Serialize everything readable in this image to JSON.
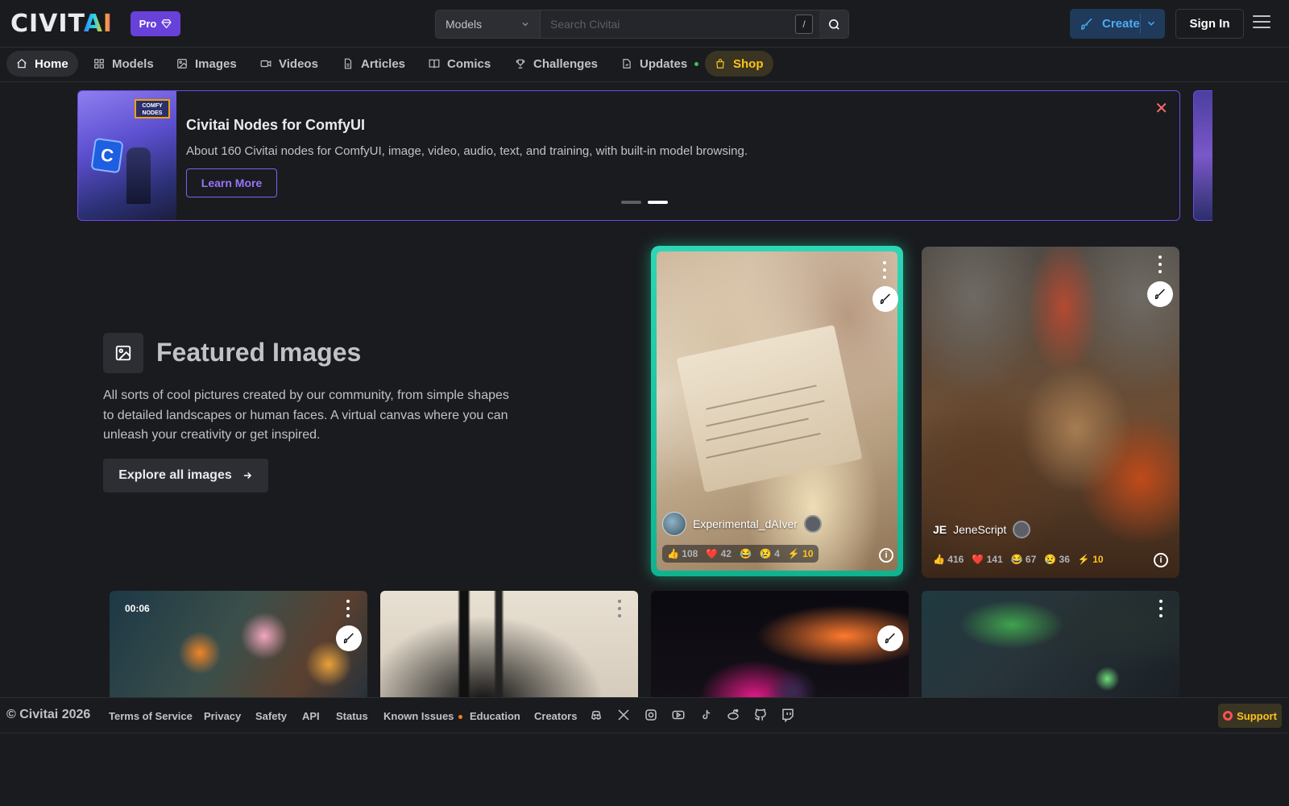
{
  "header": {
    "logo_prefix": "CIVIT",
    "logo_suffix": "AI",
    "pro_label": "Pro",
    "search": {
      "scope": "Models",
      "placeholder": "Search Civitai",
      "shortcut": "/"
    },
    "create_label": "Create",
    "signin_label": "Sign In"
  },
  "nav": {
    "items": [
      {
        "label": "Home",
        "icon": "home-icon"
      },
      {
        "label": "Models",
        "icon": "grid-icon"
      },
      {
        "label": "Images",
        "icon": "image-icon"
      },
      {
        "label": "Videos",
        "icon": "video-icon"
      },
      {
        "label": "Articles",
        "icon": "file-text-icon"
      },
      {
        "label": "Comics",
        "icon": "book-icon"
      },
      {
        "label": "Challenges",
        "icon": "trophy-icon"
      },
      {
        "label": "Updates",
        "icon": "updates-icon"
      },
      {
        "label": "Shop",
        "icon": "shopping-bag-icon"
      }
    ]
  },
  "banner": {
    "title": "Civitai Nodes for ComfyUI",
    "description": "About 160 Civitai nodes for ComfyUI, image, video, audio, text, and training, with built-in model browsing.",
    "cta": "Learn More",
    "image_text": "COMFY NODES",
    "image_logo_letter": "C"
  },
  "featured": {
    "title": "Featured Images",
    "description": "All sorts of cool pictures created by our community, from simple shapes to detailed landscapes or human faces. A virtual canvas where you can unleash your creativity or get inspired.",
    "cta": "Explore all images"
  },
  "cards": [
    {
      "username": "Experimental_dAIver",
      "reactions": {
        "like": "108",
        "heart": "42",
        "laugh": "",
        "cry": "4",
        "buzz": "10"
      }
    },
    {
      "username": "JeneScript",
      "initials": "JE",
      "reactions": {
        "like": "416",
        "heart": "141",
        "laugh": "67",
        "cry": "36",
        "buzz": "10"
      }
    }
  ],
  "video_card": {
    "duration": "00:06"
  },
  "footer": {
    "copyright": "© Civitai 2026",
    "links": [
      "Terms of Service",
      "Privacy",
      "Safety",
      "API",
      "Status",
      "Known Issues",
      "Education",
      "Creators"
    ],
    "social_icons": [
      "discord-icon",
      "x-icon",
      "instagram-icon",
      "youtube-icon",
      "tiktok-icon",
      "reddit-icon",
      "github-icon",
      "twitch-icon"
    ],
    "support_label": "Support"
  },
  "colors": {
    "background": "#1a1b1e",
    "accent_violet": "#7048e8",
    "accent_teal": "#20c997",
    "shop_yellow": "#fcc419"
  }
}
